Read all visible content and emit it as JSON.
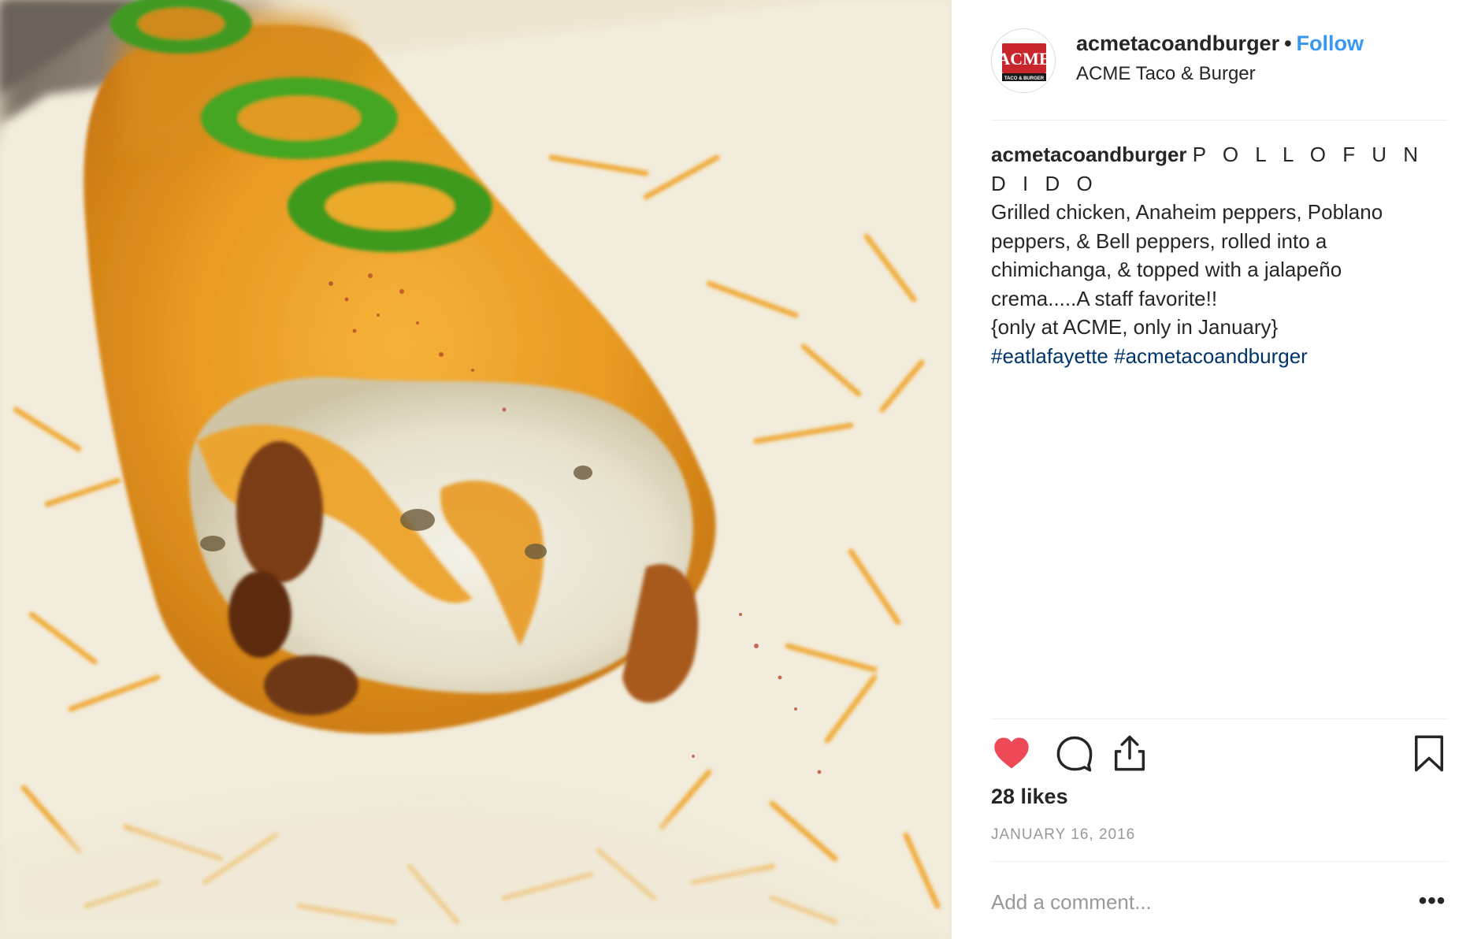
{
  "post": {
    "image_alt": "Cheese-topped chimichanga with jalapeño slices and crema",
    "header": {
      "username": "acmetacoandburger",
      "separator": "•",
      "follow_label": "Follow",
      "location": "ACME Taco & Burger",
      "avatar_logo_text": "ACME",
      "avatar_logo_subtext": "TACO & BURGER"
    },
    "caption": {
      "username": "acmetacoandburger",
      "title": "P O L L O F U N D I D O",
      "lines": [
        "Grilled chicken, Anaheim peppers, Poblano",
        "peppers, & Bell peppers, rolled into a",
        "chimichanga, & topped with a jalapeño",
        "crema.....A staff favorite!!",
        "{only at ACME, only in January}"
      ],
      "hashtags": [
        "#eatlafayette",
        "#acmetacoandburger"
      ]
    },
    "actions": {
      "like_icon": "heart-filled-icon",
      "comment_icon": "comment-bubble-icon",
      "share_icon": "share-upload-icon",
      "save_icon": "bookmark-icon",
      "like_color": "#ed4956"
    },
    "likes": "28 likes",
    "date": "JANUARY 16, 2016",
    "comment_box": {
      "placeholder": "Add a comment...",
      "more_label": "•••"
    }
  }
}
